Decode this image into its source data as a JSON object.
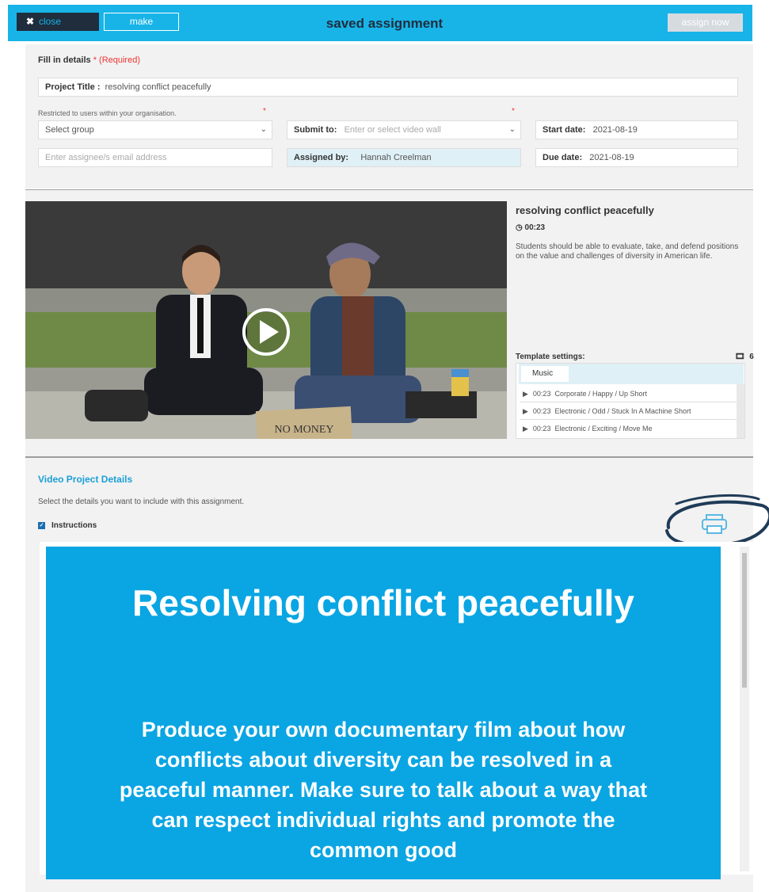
{
  "header": {
    "close_label": "close",
    "make_label": "make",
    "title": "saved assignment",
    "assign_label": "assign now"
  },
  "form": {
    "fill_label": "Fill in details",
    "required_label": "* (Required)",
    "project_title_label": "Project Title :",
    "project_title_value": "resolving conflict peacefully",
    "restricted_note": "Restricted to users within your organisation.",
    "required_star": "*",
    "group_select": "Select group",
    "submit_to_label": "Submit to:",
    "submit_to_placeholder": "Enter or select video wall",
    "start_date_label": "Start date:",
    "start_date_value": "2021-08-19",
    "email_placeholder": "Enter assignee/s email address",
    "assigned_by_label": "Assigned by:",
    "assigned_by_value": "Hannah Creelman",
    "due_date_label": "Due date:",
    "due_date_value": "2021-08-19"
  },
  "video": {
    "title": "resolving conflict peacefully",
    "duration": "00:23",
    "description": "Students should be able to evaluate, take, and defend positions on the value and challenges of diversity in American life.",
    "sign_text": "NO MONEY"
  },
  "template": {
    "label": "Template settings:",
    "count": "6",
    "tab": "Music",
    "tracks": [
      {
        "time": "00:23",
        "name": "Corporate / Happy / Up Short"
      },
      {
        "time": "00:23",
        "name": "Electronic / Odd / Stuck In A Machine Short"
      },
      {
        "time": "00:23",
        "name": "Electronic / Exciting / Move Me"
      }
    ]
  },
  "details": {
    "title": "Video Project Details",
    "subtitle": "Select the details you want to include with this assignment.",
    "instructions_label": "Instructions"
  },
  "preview": {
    "heading": "Resolving conflict peacefully",
    "body": "Produce your own documentary film about how conflicts about diversity can be resolved in a peaceful manner. Make sure to talk about a way that can respect individual rights and promote the common good"
  },
  "colors": {
    "header_bg": "#18b4e8",
    "preview_bg": "#0aa5e3",
    "link_blue": "#1a9fd6",
    "ink_navy": "#1f3b57",
    "required_red": "#ee3333"
  },
  "icons": [
    "close-icon",
    "play-icon",
    "clock-icon",
    "film-icon",
    "checkbox-icon",
    "printer-icon"
  ]
}
